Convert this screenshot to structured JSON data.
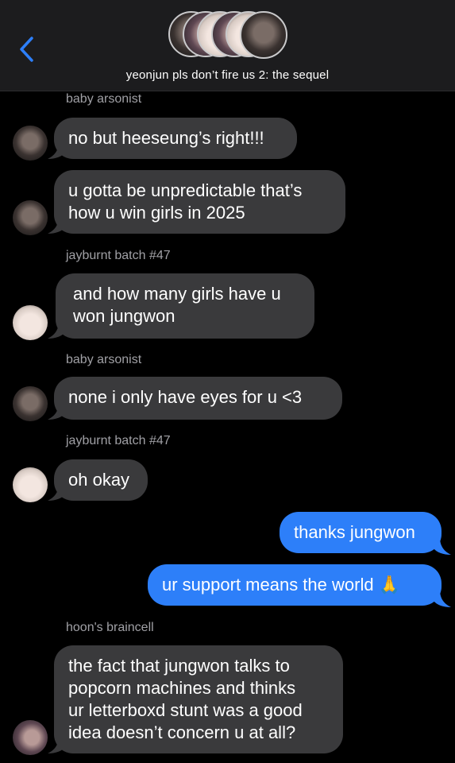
{
  "header": {
    "title": "yeonjun pls don’t fire us 2: the sequel",
    "back_icon": "chevron-left-icon",
    "accent": "#2d7ff9"
  },
  "messages": [
    {
      "sender": "baby arsonist",
      "text_lines": [
        "no but heeseung’s right!!!"
      ]
    },
    {
      "text_lines": [
        "u gotta be unpredictable that’s",
        "how u win girls in 2025"
      ]
    },
    {
      "sender": "jayburnt batch #47",
      "text_lines": [
        "and how many girls have u",
        "won jungwon"
      ]
    },
    {
      "sender": "baby arsonist",
      "text_lines": [
        "none i only have eyes for u <3"
      ]
    },
    {
      "sender": "jayburnt batch #47",
      "text_lines": [
        "oh okay"
      ]
    },
    {
      "text_lines": [
        "thanks jungwon"
      ]
    },
    {
      "text_lines": [
        "ur support means the world 🙏"
      ]
    },
    {
      "sender": "hoon's braincell",
      "text_lines": [
        "the fact that jungwon talks to",
        "popcorn machines and thinks",
        "ur letterboxd stunt was a good",
        "idea doesn’t concern u at all?"
      ]
    }
  ],
  "colors": {
    "incoming_bubble": "#3a3a3c",
    "outgoing_bubble": "#2d7ff9",
    "background": "#000000",
    "header_bg": "#1c1c1e"
  }
}
